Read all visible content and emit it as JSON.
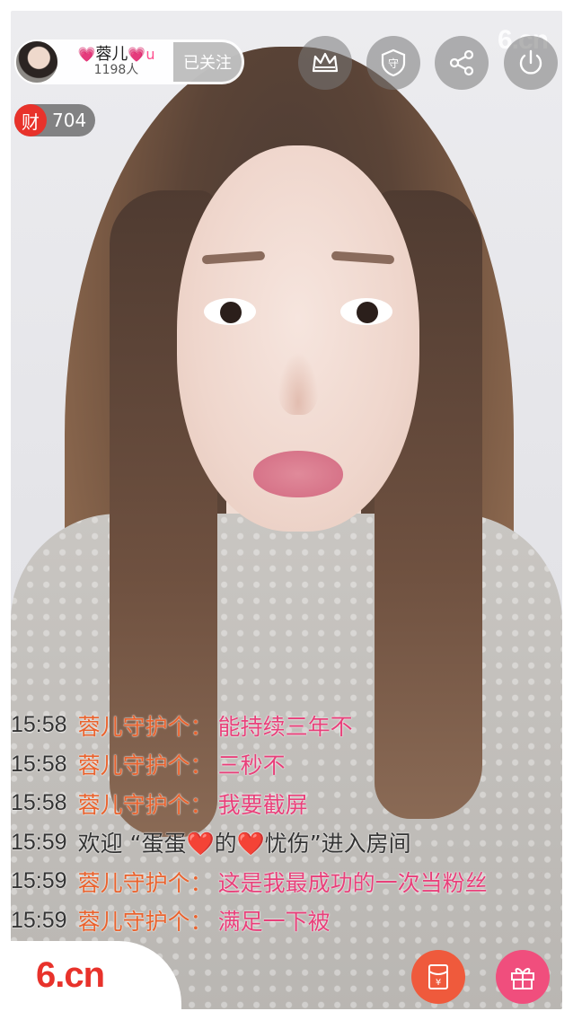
{
  "watermark": "6.cn",
  "host": {
    "name_prefix": "💗",
    "name": "蓉儿",
    "name_suffix": "💗u",
    "fans": "1198人",
    "follow_label": "已关注"
  },
  "top_icons": [
    "crown-icon",
    "guard-shield-icon",
    "share-icon",
    "power-icon"
  ],
  "guard_label": "守",
  "wealth": {
    "badge": "财",
    "count": "704"
  },
  "chat": [
    {
      "time": "15:58",
      "user": "蓉儿守护个",
      "colon": "：",
      "msg": "能持续三年不"
    },
    {
      "time": "15:58",
      "user": "蓉儿守护个",
      "colon": "：",
      "msg": "三秒不"
    },
    {
      "time": "15:58",
      "user": "蓉儿守护个",
      "colon": "：",
      "msg": "我要截屏"
    },
    {
      "time": "15:59",
      "system": "欢迎 “蛋蛋❤️的❤️忧伤”进入房间"
    },
    {
      "time": "15:59",
      "user": "蓉儿守护个",
      "colon": "：",
      "msg": "这是我最成功的一次当粉丝"
    },
    {
      "time": "15:59",
      "user": "蓉儿守护个",
      "colon": "：",
      "msg": "满足一下被"
    }
  ],
  "bottom": {
    "logo": "6.cn",
    "redpacket_symbol": "¥",
    "redpacket_color": "#ef5a3c",
    "gift_color": "#f04e7d"
  },
  "colors": {
    "accent": "#e8322b",
    "chat_user": "#e9622d",
    "chat_msg": "#e8407a"
  }
}
